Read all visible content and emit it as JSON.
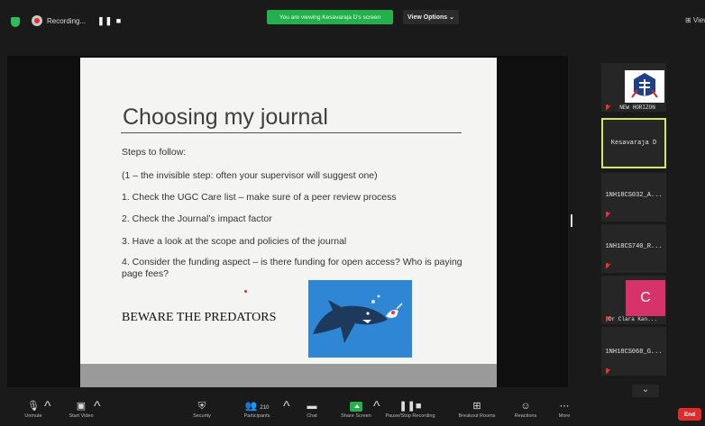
{
  "topbar": {
    "recording_label": "Recording...",
    "rec_controls": "❚❚ ■",
    "viewing_banner": "You are viewing Kesavaraja D's screen",
    "view_options": "View Options ⌄",
    "right_view": "⊞ View"
  },
  "slide": {
    "title": "Choosing my journal",
    "lines": [
      "Steps to follow:",
      "(1 – the invisible step: often your supervisor will suggest one)",
      "1. Check the UGC Care list – make sure of a peer review process",
      "2. Check the Journal’s impact factor",
      "3. Have a look at the scope and policies of the journal",
      "4. Consider the funding aspect – is there funding for open access? Who is paying page fees?"
    ],
    "beware": "BEWARE THE PREDATORS"
  },
  "participants": [
    {
      "name": "NEW HORIZON",
      "muted": true,
      "type": "logo"
    },
    {
      "name": "Kesavaraja D",
      "muted": false,
      "type": "active"
    },
    {
      "name": "1NH18CS032_A...",
      "muted": true,
      "type": "name"
    },
    {
      "name": "1NH18CS740_R...",
      "muted": true,
      "type": "name"
    },
    {
      "name": "Dr Clara Kan...",
      "muted": true,
      "type": "avatar",
      "initial": "C",
      "avatar_color": "#d8326b"
    },
    {
      "name": "1NH18CS068_G...",
      "muted": true,
      "type": "name"
    }
  ],
  "toolbar": {
    "unmute": "Unmute",
    "start_video": "Start Video",
    "security": "Security",
    "participants": "Participants",
    "participants_count": "210",
    "chat": "Chat",
    "share_screen": "Share Screen",
    "record": "Pause/Stop Recording",
    "breakout": "Breakout Rooms",
    "reactions": "Reactions",
    "more": "More",
    "end": "End"
  },
  "colors": {
    "accent_green": "#22b14c",
    "end_red": "#e02b2b",
    "active_border": "#d4e85a",
    "muted_red": "#e33333"
  }
}
